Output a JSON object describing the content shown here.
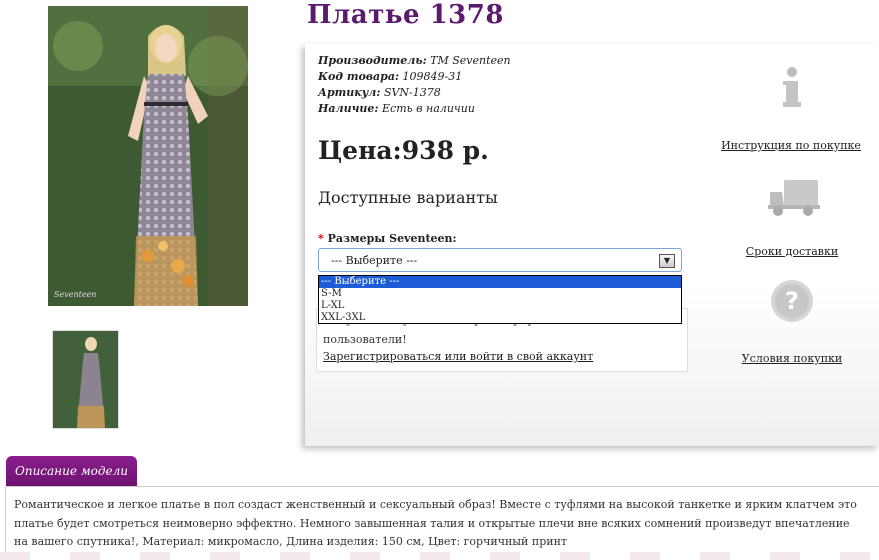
{
  "product": {
    "title": "Платье 1378",
    "info": [
      {
        "label": "Производитель:",
        "value": "TM Seventeen"
      },
      {
        "label": "Код товара:",
        "value": "109849-31"
      },
      {
        "label": "Артикул:",
        "value": "SVN-1378"
      },
      {
        "label": "Наличие:",
        "value": "Есть в наличии"
      }
    ],
    "price": "Цена:938 р.",
    "variants_heading": "Доступные варианты",
    "size_label": "Размеры Seventeen:",
    "required_mark": "*",
    "select_value": "--- Выберите ---",
    "size_options": [
      "--- Выберите ---",
      "S-M",
      "L-XL",
      "XXL-3XL"
    ],
    "image_watermark": "Seventeen"
  },
  "notice": {
    "line1": "Покупать могут только зарегистрированные",
    "line2": "пользователи!",
    "link": "Зарегистрироваться или войти в свой аккаунт"
  },
  "sidebar": {
    "links": [
      {
        "icon": "info-icon",
        "label": "Инструкция по покупке"
      },
      {
        "icon": "truck-icon",
        "label": "Сроки доставки"
      },
      {
        "icon": "question-icon",
        "label": "Условия покупки"
      }
    ]
  },
  "description": {
    "tab": "Описание модели",
    "text": "Романтическое и легкое платье в пол создаст женственный и сексуальный образ! Вместе с туфлями на высокой танкетке и ярким клатчем это платье будет смотреться неимоверно эффектно. Немного завышенная талия и открытые плечи вне всяких сомнений произведут впечатление на вашего спутника!, Материал: микромасло, Длина изделия: 150 см, Цвет: горчичный принт"
  },
  "colors": {
    "title": "#5b1a6e",
    "tab": "#7a1680",
    "select_highlight": "#1e5bd6"
  }
}
